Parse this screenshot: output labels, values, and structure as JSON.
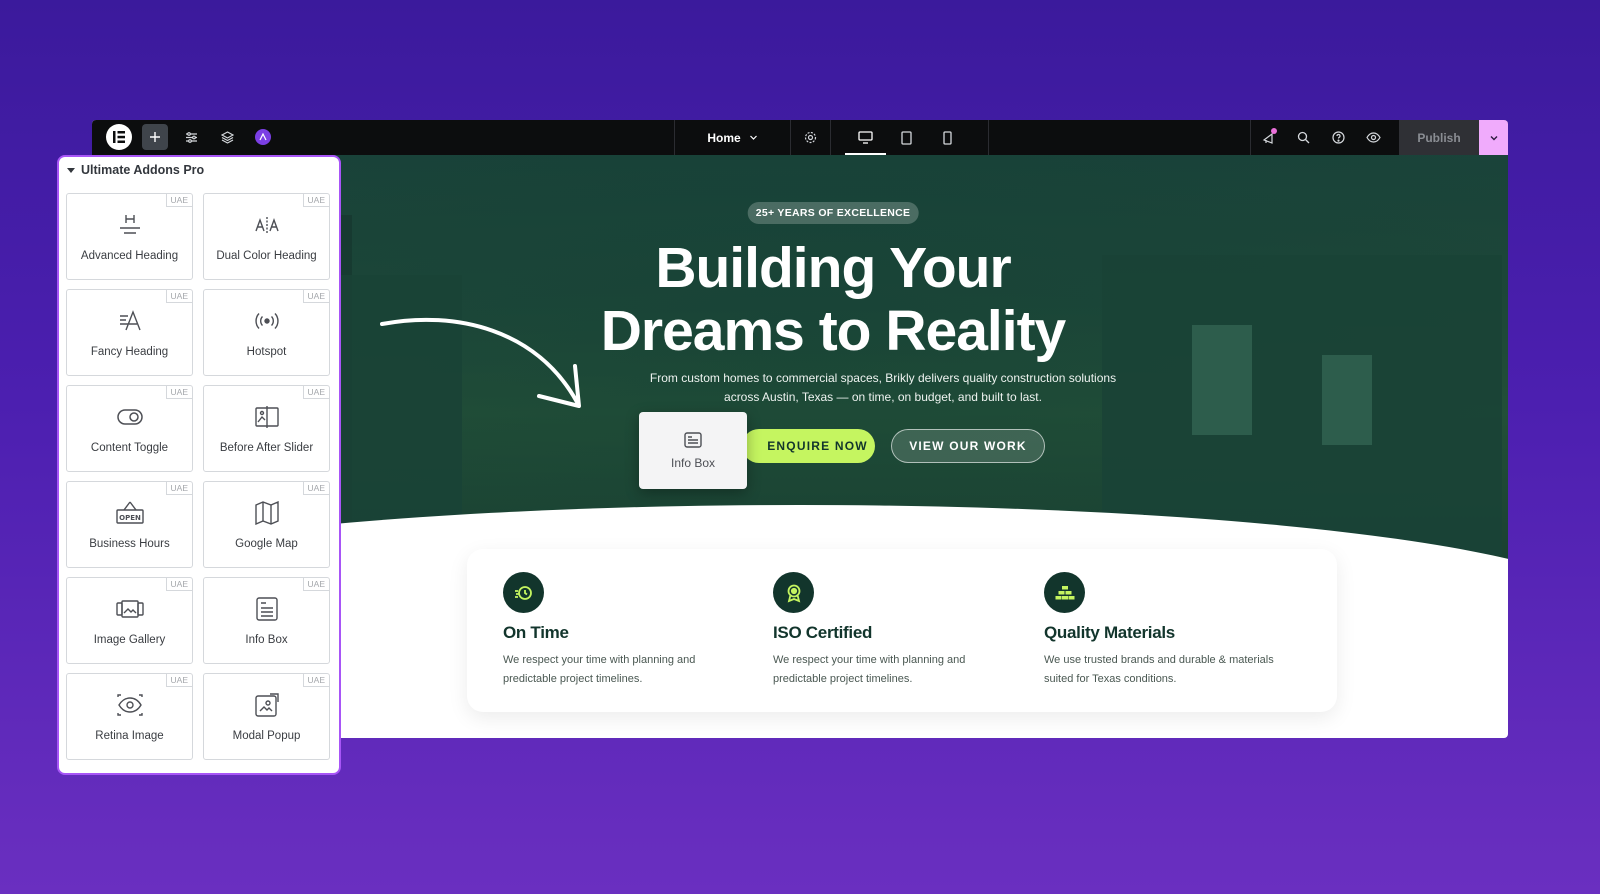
{
  "topbar": {
    "page_selector": "Home",
    "publish_label": "Publish"
  },
  "hero": {
    "badge": "25+ YEARS OF EXCELLENCE",
    "headline_line1": "Building Your",
    "headline_line2": "Dreams to Reality",
    "subtext": "From custom homes to commercial spaces, Brikly delivers quality construction solutions across Austin, Texas — on time, on budget, and built to last.",
    "cta_primary": "ENQUIRE NOW",
    "cta_secondary": "VIEW OUR WORK"
  },
  "drag_preview": {
    "label": "Info Box"
  },
  "features": [
    {
      "title": "On Time",
      "desc": "We respect your time with planning and predictable project timelines."
    },
    {
      "title": "ISO Certified",
      "desc": "We respect your time with planning and predictable project timelines."
    },
    {
      "title": "Quality Materials",
      "desc": "We use trusted brands and durable & materials suited for Texas conditions."
    }
  ],
  "panel": {
    "title": "Ultimate Addons Pro",
    "tag": "UAE",
    "widgets": [
      {
        "label": "Advanced Heading",
        "icon": "advanced-heading-icon"
      },
      {
        "label": "Dual Color Heading",
        "icon": "dual-color-heading-icon"
      },
      {
        "label": "Fancy Heading",
        "icon": "fancy-heading-icon"
      },
      {
        "label": "Hotspot",
        "icon": "hotspot-icon"
      },
      {
        "label": "Content Toggle",
        "icon": "toggle-icon"
      },
      {
        "label": "Before After Slider",
        "icon": "before-after-icon"
      },
      {
        "label": "Business Hours",
        "icon": "open-sign-icon"
      },
      {
        "label": "Google Map",
        "icon": "map-icon"
      },
      {
        "label": "Image Gallery",
        "icon": "gallery-icon"
      },
      {
        "label": "Info Box",
        "icon": "info-box-icon"
      },
      {
        "label": "Retina Image",
        "icon": "eye-icon"
      },
      {
        "label": "Modal Popup",
        "icon": "modal-popup-icon"
      }
    ]
  },
  "colors": {
    "accent_green": "#c5f560",
    "dark_green": "#12352c",
    "panel_border": "#a855f7",
    "publish_dropdown": "#f0abfc"
  }
}
